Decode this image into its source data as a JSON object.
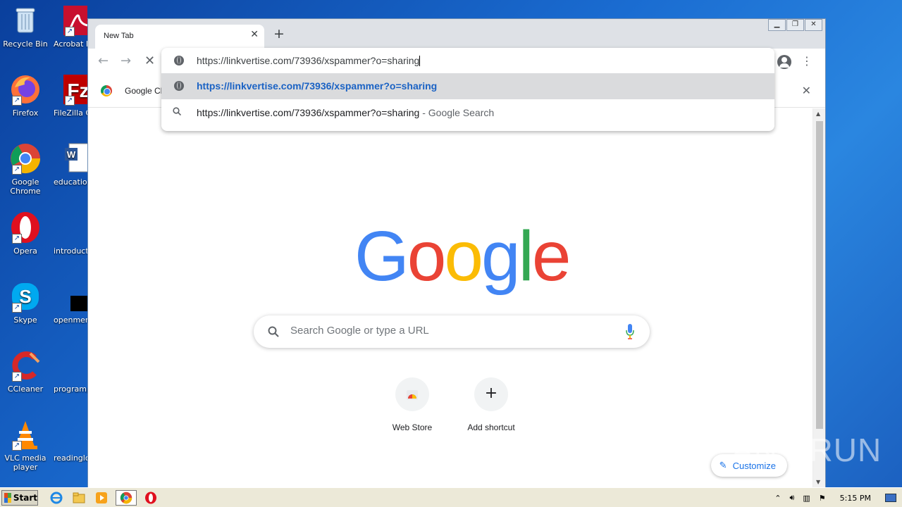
{
  "desktop": {
    "icons": [
      {
        "label": "Recycle Bin",
        "icon": "recycle-bin-icon"
      },
      {
        "label": "Firefox",
        "icon": "firefox-icon"
      },
      {
        "label": "Google Chrome",
        "icon": "chrome-icon"
      },
      {
        "label": "Opera",
        "icon": "opera-icon"
      },
      {
        "label": "Skype",
        "icon": "skype-icon"
      },
      {
        "label": "CCleaner",
        "icon": "ccleaner-icon"
      },
      {
        "label": "VLC media player",
        "icon": "vlc-icon"
      }
    ],
    "partial_icons": [
      {
        "label": "Acrobat Reader",
        "icon": "acrobat-icon"
      },
      {
        "label": "FileZilla C",
        "icon": "filezilla-icon"
      },
      {
        "label": "education",
        "icon": "word-doc-icon"
      },
      {
        "label": "introducti",
        "icon": "file-icon"
      },
      {
        "label": "openmem",
        "icon": "file-icon"
      },
      {
        "label": "programp",
        "icon": "file-icon"
      },
      {
        "label": "readinglo",
        "icon": "file-icon"
      }
    ]
  },
  "browser": {
    "tab_title": "New Tab",
    "bookmark_label": "Google Cl",
    "omnibox": {
      "typed_value": "https://linkvertise.com/73936/xspammer?o=sharing",
      "suggestion_url": "https://linkvertise.com/73936/xspammer?o=sharing",
      "suggestion_search": "https://linkvertise.com/73936/xspammer?o=sharing",
      "suggestion_search_suffix": " - Google Search"
    },
    "page": {
      "search_placeholder": "Search Google or type a URL",
      "shortcuts": [
        {
          "label": "Web Store"
        },
        {
          "label": "Add shortcut"
        }
      ],
      "customize_label": "Customize"
    }
  },
  "watermark": "ANY RUN",
  "taskbar": {
    "start_label": "Start",
    "clock": "5:15 PM"
  },
  "colors": {
    "google_blue": "#4285f4",
    "google_red": "#ea4335",
    "google_yellow": "#fbbc05",
    "google_green": "#34a853",
    "suggestion_highlight": "#dadbdd",
    "link_blue": "#1a62c4"
  }
}
